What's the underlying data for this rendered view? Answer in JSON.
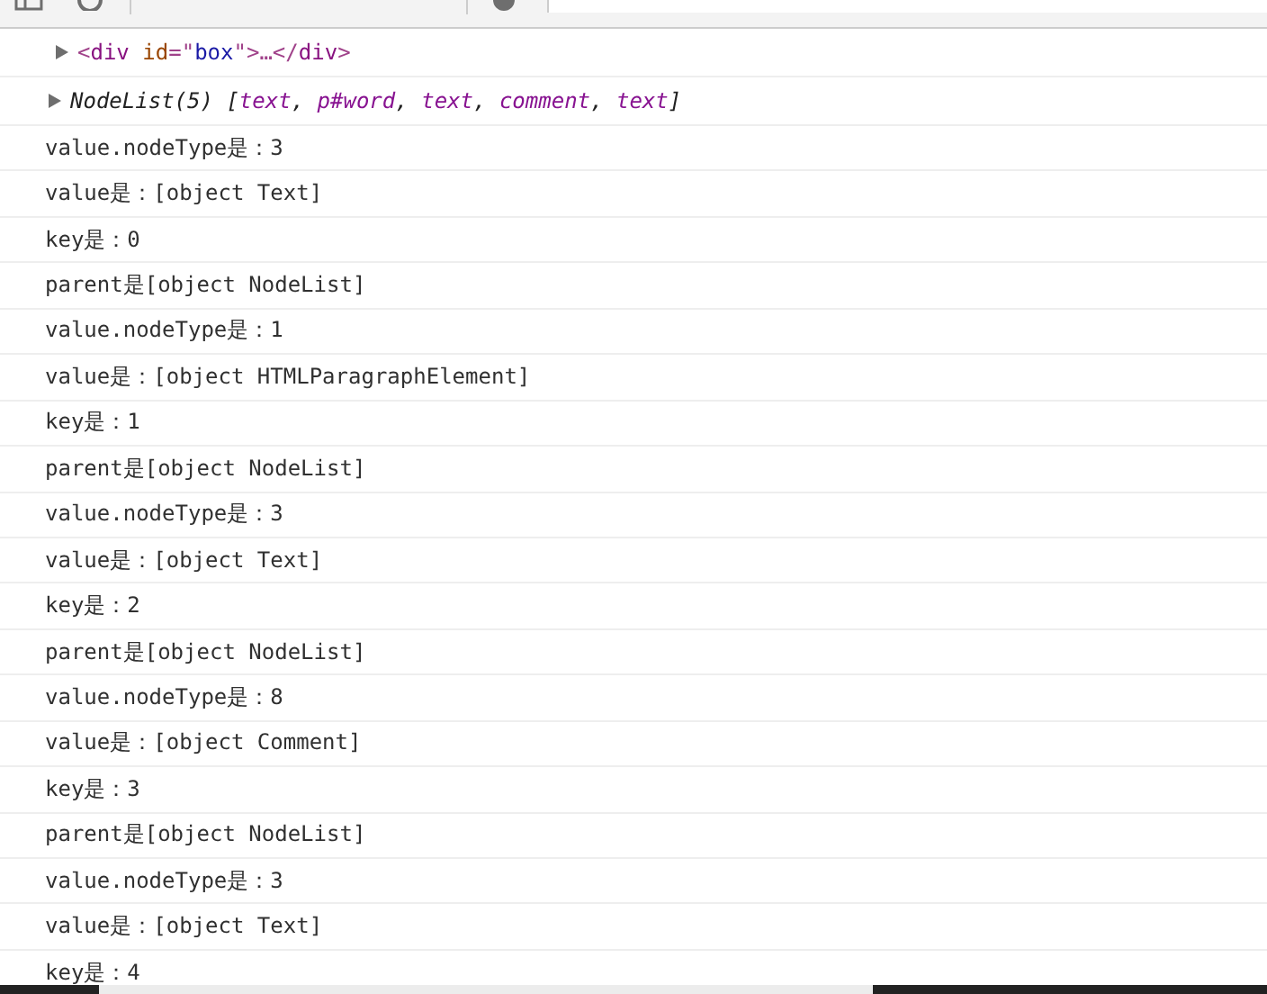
{
  "entries": [
    {
      "kind": "element",
      "expanded": false,
      "tokens": [
        {
          "kind": "punct",
          "text": "<"
        },
        {
          "kind": "tag",
          "text": "div"
        },
        {
          "kind": "attr",
          "text": " id"
        },
        {
          "kind": "punct",
          "text": "=\""
        },
        {
          "kind": "value",
          "text": "box"
        },
        {
          "kind": "punct",
          "text": "\">…</"
        },
        {
          "kind": "tag",
          "text": "div"
        },
        {
          "kind": "punct",
          "text": ">"
        }
      ]
    },
    {
      "kind": "nodelist",
      "expanded": false,
      "tokens": [
        {
          "kind": "plain",
          "text": "NodeList(5) ["
        },
        {
          "kind": "item",
          "text": "text"
        },
        {
          "kind": "plain",
          "text": ", "
        },
        {
          "kind": "item",
          "text": "p#word"
        },
        {
          "kind": "plain",
          "text": ", "
        },
        {
          "kind": "item",
          "text": "text"
        },
        {
          "kind": "plain",
          "text": ", "
        },
        {
          "kind": "item",
          "text": "comment"
        },
        {
          "kind": "plain",
          "text": ", "
        },
        {
          "kind": "item",
          "text": "text"
        },
        {
          "kind": "plain",
          "text": "]"
        }
      ]
    }
  ],
  "log_lines": [
    "value.nodeType是：3",
    "value是：[object Text]",
    "key是：0",
    "parent是[object NodeList]",
    "value.nodeType是：1",
    "value是：[object HTMLParagraphElement]",
    "key是：1",
    "parent是[object NodeList]",
    "value.nodeType是：3",
    "value是：[object Text]",
    "key是：2",
    "parent是[object NodeList]",
    "value.nodeType是：8",
    "value是：[object Comment]",
    "key是：3",
    "parent是[object NodeList]",
    "value.nodeType是：3",
    "value是：[object Text]",
    "key是：4"
  ]
}
